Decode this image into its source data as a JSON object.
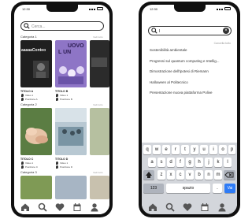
{
  "left_phone": {
    "time": "12:30",
    "search_placeholder": "Cerca...",
    "categories": [
      {
        "name": "Categoria 1",
        "more": "Vedi tutto",
        "cards": [
          {
            "title": "TITOLO A",
            "meta1": "Video 1",
            "meta2": "Posizione A",
            "poster": "aaaaaConteo",
            "poster2": "",
            "bg": "#1f1f1f"
          },
          {
            "title": "TITOLO B",
            "meta1": "Video 1",
            "meta2": "Posizione B",
            "poster": "UOVO",
            "poster2": "L UN",
            "bg": "#8e75c6"
          }
        ]
      },
      {
        "name": "Categoria 2",
        "more": "Vedi tutto",
        "cards": [
          {
            "title": "TITOLO C",
            "meta1": "Video 1",
            "meta2": "Posizione C",
            "poster": "",
            "poster2": "",
            "bg": "#5d7d43"
          },
          {
            "title": "TITOLO D",
            "meta1": "Video 1",
            "meta2": "Posizione D",
            "poster": "",
            "poster2": "",
            "bg": "#8fa9b8"
          }
        ]
      },
      {
        "name": "Categoria 3",
        "more": "Vedi tutto",
        "cards": []
      }
    ]
  },
  "right_phone": {
    "time": "12:30",
    "search_value": "I",
    "cancel_label": "Cancella tutto",
    "results": [
      "Sostenibilità ambientale",
      "Progressi sul quantum computing e Intellig...",
      "Dimostrazione dell'ipotesi di Riemann",
      "Halloween al Politecnico",
      "Presentazione nuova piattaforma Polive"
    ],
    "keyboard": {
      "row1": [
        "q",
        "w",
        "e",
        "r",
        "t",
        "y",
        "u",
        "i",
        "o",
        "p"
      ],
      "row2": [
        "a",
        "s",
        "d",
        "f",
        "g",
        "h",
        "j",
        "k",
        "l"
      ],
      "row3": [
        "z",
        "x",
        "c",
        "v",
        "b",
        "n",
        "m"
      ],
      "num_key": "123",
      "space_key": "spazio",
      "dot_key": ".",
      "go_key": "Vai",
      "shift_icon": "shift-icon",
      "delete_icon": "backspace-icon"
    }
  },
  "nav_icons": [
    "home-icon",
    "search-icon",
    "heart-icon",
    "calendar-icon",
    "profile-icon"
  ],
  "colors": {
    "phone": "#101010",
    "accent": "#2f7cf6",
    "keyboard": "#d3d6db"
  }
}
